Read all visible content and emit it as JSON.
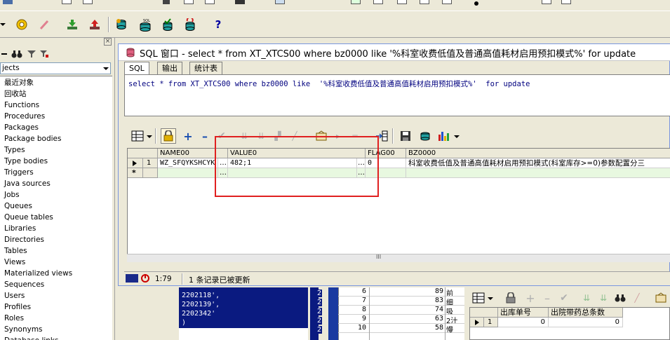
{
  "left_panel": {
    "combo_text": "jects",
    "items": [
      "最近对象",
      "回收站",
      "Functions",
      "Procedures",
      "Packages",
      "Package bodies",
      "Types",
      "Type bodies",
      "Triggers",
      "Java sources",
      "Jobs",
      "Queues",
      "Queue tables",
      "Libraries",
      "Directories",
      "Tables",
      "Views",
      "Materialized views",
      "Sequences",
      "Users",
      "Profiles",
      "Roles",
      "Synonyms",
      "Database links"
    ]
  },
  "sql_window": {
    "title": "SQL 窗口 - select * from XT_XTCS00 where bz0000 like '%科室收费低值及普通高值耗材启用预扣模式%' for update",
    "tabs": [
      "SQL",
      "输出",
      "统计表"
    ],
    "sql_text": "select * from XT_XTCS00 where bz0000 like  '%科室收费低值及普通高值耗材启用预扣模式%'  for update",
    "grid": {
      "headers": [
        "NAME00",
        "VALUE0",
        "FLAG00",
        "BZ0000"
      ],
      "rows": [
        {
          "num": "1",
          "NAME00": "WZ_SFQYKSHCYK",
          "VALUE0": "482;1",
          "FLAG00": "0",
          "BZ0000": "科室收费低值及普通高值耗材启用预扣模式(科室库存>=0)参数配置分三"
        }
      ],
      "ellipsis": "…",
      "new_row_marker": "*",
      "scroll_mark": "III"
    },
    "status": {
      "position": "1:79",
      "message": "1 条记录已被更新"
    }
  },
  "bottom": {
    "code_lines": [
      "2202118',",
      "2202139',",
      "2202342'"
    ],
    "code_digits": [
      "2",
      "2",
      "2",
      "2",
      "2"
    ],
    "code_close": ")",
    "list_rows": [
      {
        "num": "6",
        "value": "89",
        "text": "前"
      },
      {
        "num": "7",
        "value": "83",
        "text": "细"
      },
      {
        "num": "8",
        "value": "74",
        "text": "吸"
      },
      {
        "num": "9",
        "value": "63",
        "text": "2汁"
      },
      {
        "num": "10",
        "value": "58",
        "text": "慢"
      }
    ],
    "right_grid": {
      "headers": [
        "出库单号",
        "出院带药总条数"
      ],
      "row": {
        "num": "1",
        "col1": "0",
        "col2": "0"
      }
    }
  },
  "annotation_color": "#e02020"
}
